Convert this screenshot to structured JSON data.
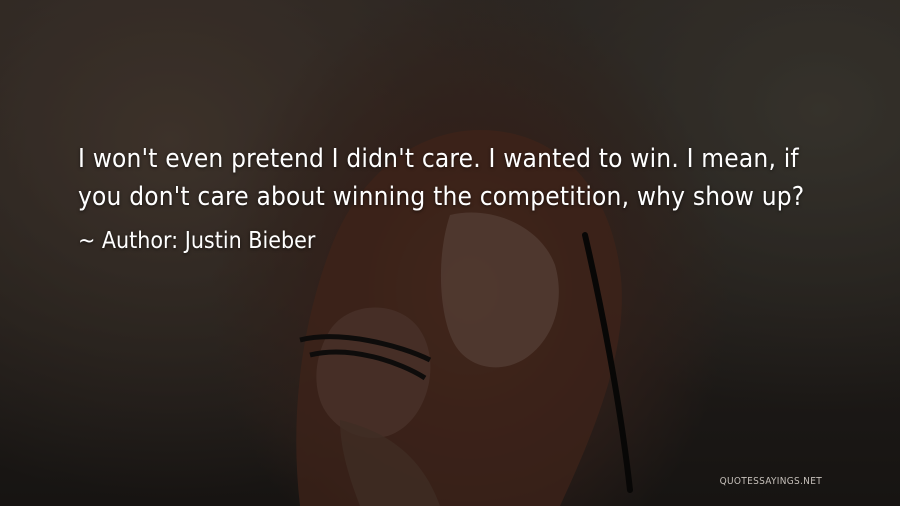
{
  "quote": {
    "text": "I won't even pretend I didn't care. I wanted to win. I mean, if you don't care about winning the competition, why show up?",
    "author_prefix": "~ Author:",
    "author_name": "Justin Bieber"
  },
  "watermark": "QUOTESSAYINGS.NET",
  "colors": {
    "text": "#ffffff",
    "background": "#2e2925",
    "hair": "#5c3426",
    "skin": "#7a5a4c"
  }
}
